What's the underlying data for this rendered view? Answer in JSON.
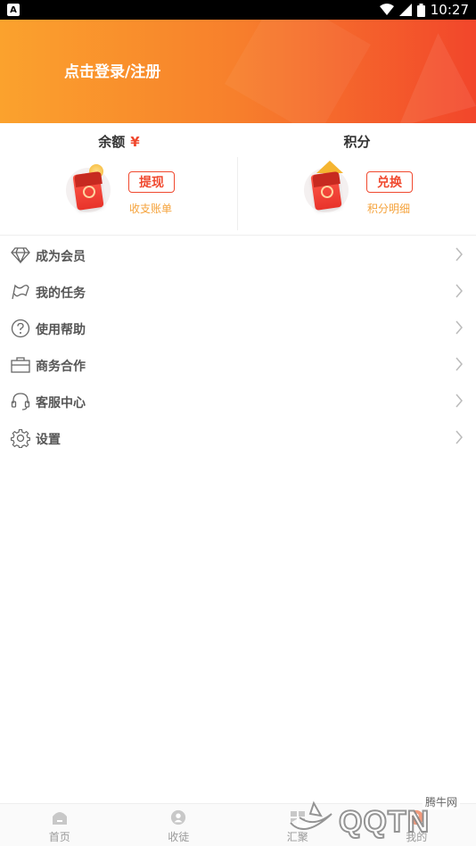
{
  "status_bar": {
    "app_indicator": "A",
    "time": "10:27"
  },
  "header": {
    "login_text": "点击登录/注册"
  },
  "assets": {
    "balance": {
      "title": "余额",
      "currency_symbol": "¥",
      "button_label": "提现",
      "link_label": "收支账单"
    },
    "points": {
      "title": "积分",
      "button_label": "兑换",
      "link_label": "积分明细"
    }
  },
  "menu": {
    "items": [
      {
        "label": "成为会员",
        "icon": "diamond-icon"
      },
      {
        "label": "我的任务",
        "icon": "flag-icon"
      },
      {
        "label": "使用帮助",
        "icon": "help-circle-icon"
      },
      {
        "label": "商务合作",
        "icon": "briefcase-icon"
      },
      {
        "label": "客服中心",
        "icon": "headset-icon"
      },
      {
        "label": "设置",
        "icon": "gear-icon"
      }
    ]
  },
  "tabbar": {
    "tabs": [
      {
        "label": "首页",
        "icon": "home-icon"
      },
      {
        "label": "收徒",
        "icon": "person-icon"
      },
      {
        "label": "汇聚",
        "icon": "grid-icon"
      },
      {
        "label": "我的",
        "icon": "profile-icon"
      }
    ]
  },
  "watermark": {
    "text": "QQTN",
    "sub": "腾牛网"
  },
  "colors": {
    "accent": "#f0492f",
    "gold": "#f5a23a",
    "header_start": "#fba22d",
    "header_end": "#f2462b"
  }
}
